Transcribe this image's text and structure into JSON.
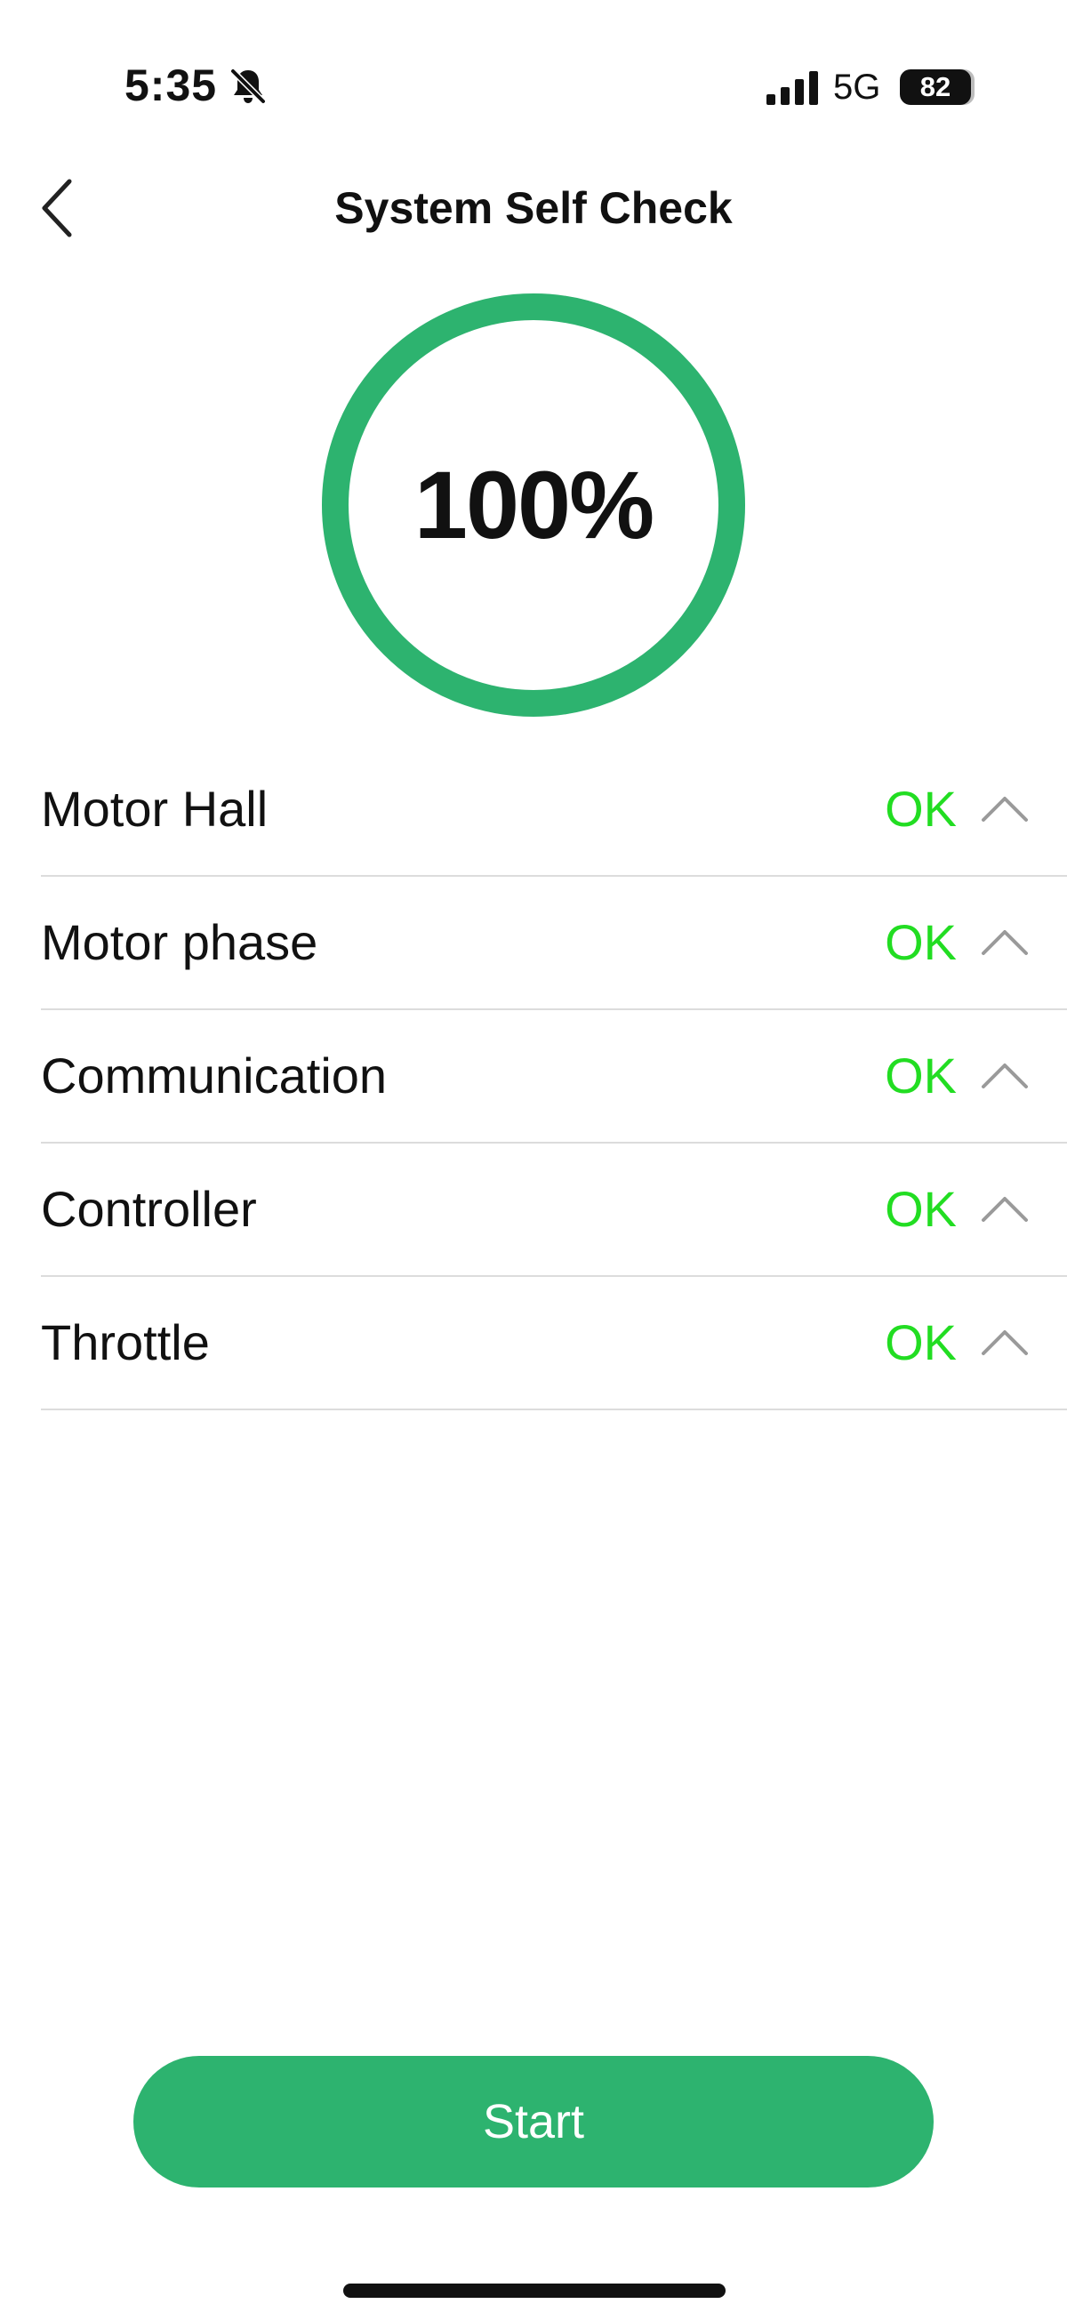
{
  "status_bar": {
    "time": "5:35",
    "network": "5G",
    "battery": "82",
    "icons": [
      "bell-slash-icon",
      "cellular-signal-icon",
      "battery-icon"
    ]
  },
  "header": {
    "title": "System Self Check",
    "back_icon": "chevron-left-icon"
  },
  "progress": {
    "label": "100%",
    "value": 1.0,
    "ring_color": "#2db36f",
    "track_color": "#e6e6e6"
  },
  "checks": [
    {
      "label": "Motor Hall",
      "status": "OK"
    },
    {
      "label": "Motor phase",
      "status": "OK"
    },
    {
      "label": "Communication",
      "status": "OK"
    },
    {
      "label": "Controller",
      "status": "OK"
    },
    {
      "label": "Throttle",
      "status": "OK"
    }
  ],
  "check_icon": "chevron-up-icon",
  "colors": {
    "accent": "#2db36f",
    "status_ok": "#22dd22",
    "chevron": "#9a9a9a",
    "divider": "#dcdcdc"
  },
  "footer": {
    "start_label": "Start"
  }
}
